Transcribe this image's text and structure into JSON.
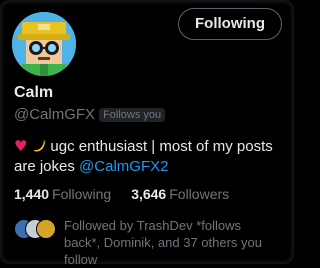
{
  "profile": {
    "name": "Calm",
    "handle": "@CalmGFX",
    "follows_you_badge": "Follows you",
    "bio_text": "ugc enthusiast | most of my posts are jokes",
    "bio_mention": "@CalmGFX2",
    "bio_emojis": [
      "heart-icon",
      "banana-icon"
    ]
  },
  "actions": {
    "following_label": "Following"
  },
  "stats": {
    "following_count": "1,440",
    "following_label": "Following",
    "followers_count": "3,646",
    "followers_label": "Followers"
  },
  "followed_by": {
    "text": "Followed by TrashDev *follows back*, Dominik, and 37 others you follow"
  },
  "colors": {
    "background": "#000000",
    "text_primary": "#e7e9ea",
    "text_secondary": "#71767b",
    "link": "#1d9bf0",
    "heart": "#e0245e"
  }
}
